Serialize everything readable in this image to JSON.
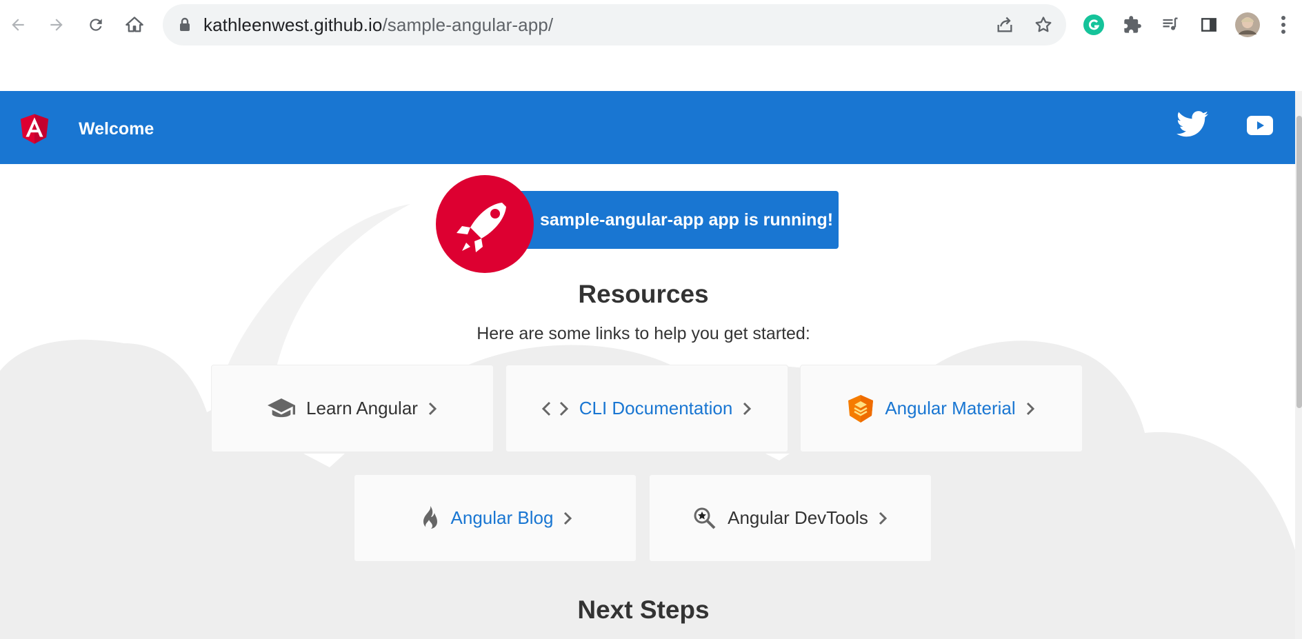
{
  "browser": {
    "url_host": "kathleenwest.github.io",
    "url_path": "/sample-angular-app/"
  },
  "toolbar": {
    "title": "Welcome"
  },
  "main": {
    "running_text": "sample-angular-app app is running!",
    "resources_heading": "Resources",
    "resources_subtitle": "Here are some links to help you get started:",
    "resources": [
      {
        "label": "Learn Angular",
        "icon": "graduation-cap-icon",
        "style": "plain"
      },
      {
        "label": "CLI Documentation",
        "icon": "code-brackets-icon",
        "style": "link"
      },
      {
        "label": "Angular Material",
        "icon": "material-logo-icon",
        "style": "link"
      },
      {
        "label": "Angular Blog",
        "icon": "flame-icon",
        "style": "link"
      },
      {
        "label": "Angular DevTools",
        "icon": "devtools-magnifier-icon",
        "style": "plain"
      }
    ],
    "next_steps_heading": "Next Steps"
  },
  "colors": {
    "toolbar_blue": "#1976d2",
    "angular_red": "#dd0031",
    "material_orange": "#f57c00",
    "link_blue": "#1976d2"
  }
}
